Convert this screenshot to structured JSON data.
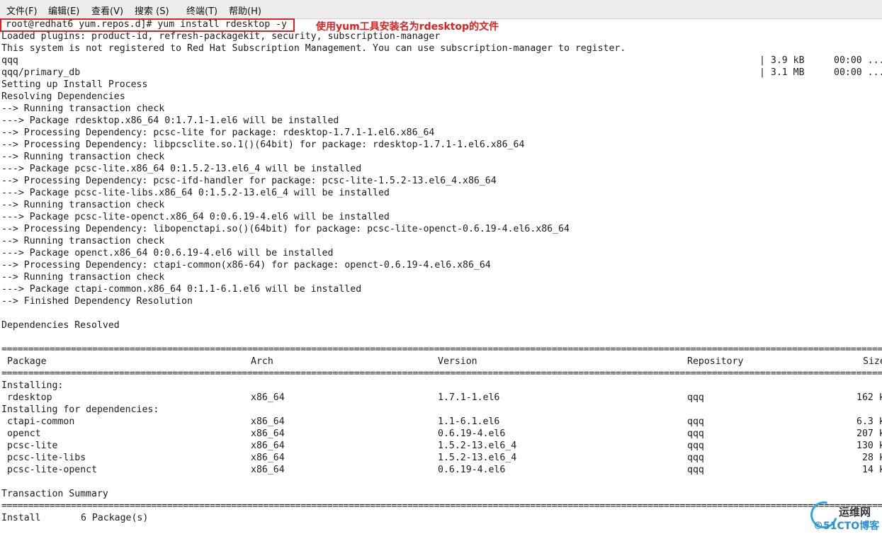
{
  "menu": [
    "文件(F)",
    "编辑(E)",
    "查看(V)",
    "搜索 (S)",
    "终端(T)",
    "帮助(H)"
  ],
  "annotation": "使用yum工具安装名为rdesktop的文件",
  "log": {
    "l1": "root@redhat6 yum.repos.d]# yum install rdesktop -y",
    "l2": "Loaded plugins: product-id, refresh-packagekit, security, subscription-manager",
    "l3": "This system is not registered to Red Hat Subscription Management. You can use subscription-manager to register.",
    "l4_name": "qqq",
    "l4_size": "| 3.9 kB",
    "l4_time": "00:00 ...",
    "l5_name": "qqq/primary_db",
    "l5_size": "| 3.1 MB",
    "l5_time": "00:00 ...",
    "l6": "Setting up Install Process",
    "l7": "Resolving Dependencies",
    "l8": "--> Running transaction check",
    "l9": "---> Package rdesktop.x86_64 0:1.7.1-1.el6 will be installed",
    "l10": "--> Processing Dependency: pcsc-lite for package: rdesktop-1.7.1-1.el6.x86_64",
    "l11": "--> Processing Dependency: libpcsclite.so.1()(64bit) for package: rdesktop-1.7.1-1.el6.x86_64",
    "l12": "--> Running transaction check",
    "l13": "---> Package pcsc-lite.x86_64 0:1.5.2-13.el6_4 will be installed",
    "l14": "--> Processing Dependency: pcsc-ifd-handler for package: pcsc-lite-1.5.2-13.el6_4.x86_64",
    "l15": "---> Package pcsc-lite-libs.x86_64 0:1.5.2-13.el6_4 will be installed",
    "l16": "--> Running transaction check",
    "l17": "---> Package pcsc-lite-openct.x86_64 0:0.6.19-4.el6 will be installed",
    "l18": "--> Processing Dependency: libopenctapi.so()(64bit) for package: pcsc-lite-openct-0.6.19-4.el6.x86_64",
    "l19": "--> Running transaction check",
    "l20": "---> Package openct.x86_64 0:0.6.19-4.el6 will be installed",
    "l21": "--> Processing Dependency: ctapi-common(x86-64) for package: openct-0.6.19-4.el6.x86_64",
    "l22": "--> Running transaction check",
    "l23": "---> Package ctapi-common.x86_64 0:1.1-6.1.el6 will be installed",
    "l24": "--> Finished Dependency Resolution",
    "l26": "Dependencies Resolved"
  },
  "table": {
    "headers": [
      "Package",
      "Arch",
      "Version",
      "Repository",
      "Size"
    ],
    "installing_label": "Installing:",
    "deps_label": "Installing for dependencies:",
    "installing": [
      {
        "name": "rdesktop",
        "arch": "x86_64",
        "version": "1.7.1-1.el6",
        "repo": "qqq",
        "size": "162 k"
      }
    ],
    "deps": [
      {
        "name": "ctapi-common",
        "arch": "x86_64",
        "version": "1.1-6.1.el6",
        "repo": "qqq",
        "size": "6.3 k"
      },
      {
        "name": "openct",
        "arch": "x86_64",
        "version": "0.6.19-4.el6",
        "repo": "qqq",
        "size": "207 k"
      },
      {
        "name": "pcsc-lite",
        "arch": "x86_64",
        "version": "1.5.2-13.el6_4",
        "repo": "qqq",
        "size": "130 k"
      },
      {
        "name": "pcsc-lite-libs",
        "arch": "x86_64",
        "version": "1.5.2-13.el6_4",
        "repo": "qqq",
        "size": "28 k"
      },
      {
        "name": "pcsc-lite-openct",
        "arch": "x86_64",
        "version": "0.6.19-4.el6",
        "repo": "qqq",
        "size": "14 k"
      }
    ],
    "summary_label": "Transaction Summary",
    "install_label": "Install",
    "install_count": "6 Package(s)"
  },
  "separator_char": "=",
  "watermark": {
    "top": "运维网",
    "bottom": "©51CTO博客"
  },
  "colors": {
    "annotation": "#e0201c",
    "watermark": "#2aa7e0"
  }
}
